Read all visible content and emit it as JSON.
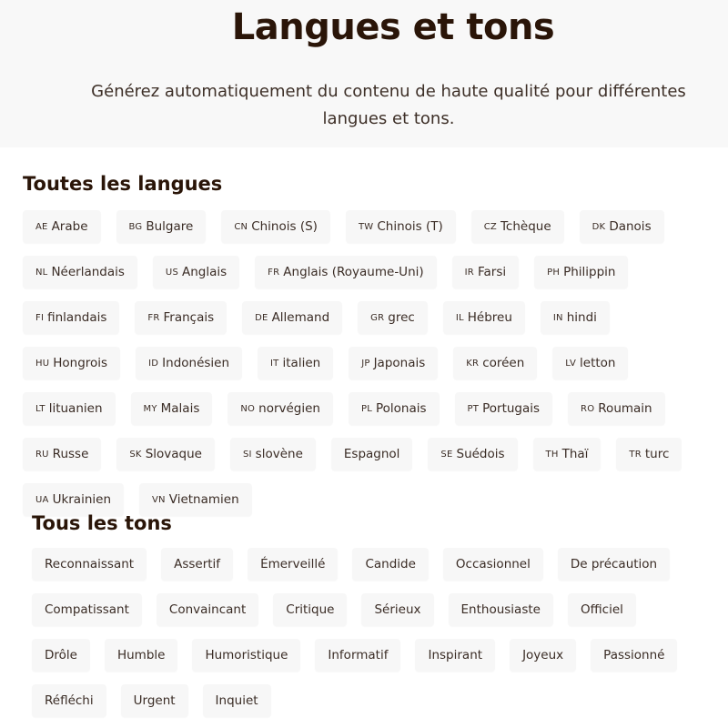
{
  "header": {
    "title": "Langues et tons",
    "subtitle": "Générez automatiquement du contenu de haute qualité pour différentes langues et tons."
  },
  "languages": {
    "heading": "Toutes les langues",
    "items": [
      {
        "code": "AE",
        "label": "Arabe"
      },
      {
        "code": "BG",
        "label": "Bulgare"
      },
      {
        "code": "CN",
        "label": "Chinois (S)"
      },
      {
        "code": "TW",
        "label": "Chinois (T)"
      },
      {
        "code": "CZ",
        "label": "Tchèque"
      },
      {
        "code": "DK",
        "label": "Danois"
      },
      {
        "code": "NL",
        "label": "Néerlandais"
      },
      {
        "code": "US",
        "label": "Anglais"
      },
      {
        "code": "FR",
        "label": "Anglais (Royaume-Uni)"
      },
      {
        "code": "IR",
        "label": "Farsi"
      },
      {
        "code": "PH",
        "label": "Philippin"
      },
      {
        "code": "FI",
        "label": "finlandais"
      },
      {
        "code": "FR",
        "label": "Français"
      },
      {
        "code": "DE",
        "label": "Allemand"
      },
      {
        "code": "GR",
        "label": "grec"
      },
      {
        "code": "IL",
        "label": "Hébreu"
      },
      {
        "code": "IN",
        "label": "hindi"
      },
      {
        "code": "HU",
        "label": "Hongrois"
      },
      {
        "code": "ID",
        "label": "Indonésien"
      },
      {
        "code": "IT",
        "label": "italien"
      },
      {
        "code": "JP",
        "label": "Japonais"
      },
      {
        "code": "KR",
        "label": "coréen"
      },
      {
        "code": "LV",
        "label": "letton"
      },
      {
        "code": "LT",
        "label": "lituanien"
      },
      {
        "code": "MY",
        "label": "Malais"
      },
      {
        "code": "NO",
        "label": "norvégien"
      },
      {
        "code": "PL",
        "label": "Polonais"
      },
      {
        "code": "PT",
        "label": "Portugais"
      },
      {
        "code": "RO",
        "label": "Roumain"
      },
      {
        "code": "RU",
        "label": "Russe"
      },
      {
        "code": "SK",
        "label": "Slovaque"
      },
      {
        "code": "SI",
        "label": "slovène"
      },
      {
        "code": "",
        "label": "Espagnol"
      },
      {
        "code": "SE",
        "label": "Suédois"
      },
      {
        "code": "TH",
        "label": "Thaï"
      },
      {
        "code": "TR",
        "label": "turc"
      },
      {
        "code": "UA",
        "label": "Ukrainien"
      },
      {
        "code": "VN",
        "label": "Vietnamien"
      }
    ]
  },
  "tones": {
    "heading": "Tous les tons",
    "items": [
      "Reconnaissant",
      "Assertif",
      "Émerveillé",
      "Candide",
      "Occasionnel",
      "De précaution",
      "Compatissant",
      "Convaincant",
      "Critique",
      "Sérieux",
      "Enthousiaste",
      "Officiel",
      "Drôle",
      "Humble",
      "Humoristique",
      "Informatif",
      "Inspirant",
      "Joyeux",
      "Passionné",
      "Réfléchi",
      "Urgent",
      "Inquiet"
    ]
  }
}
